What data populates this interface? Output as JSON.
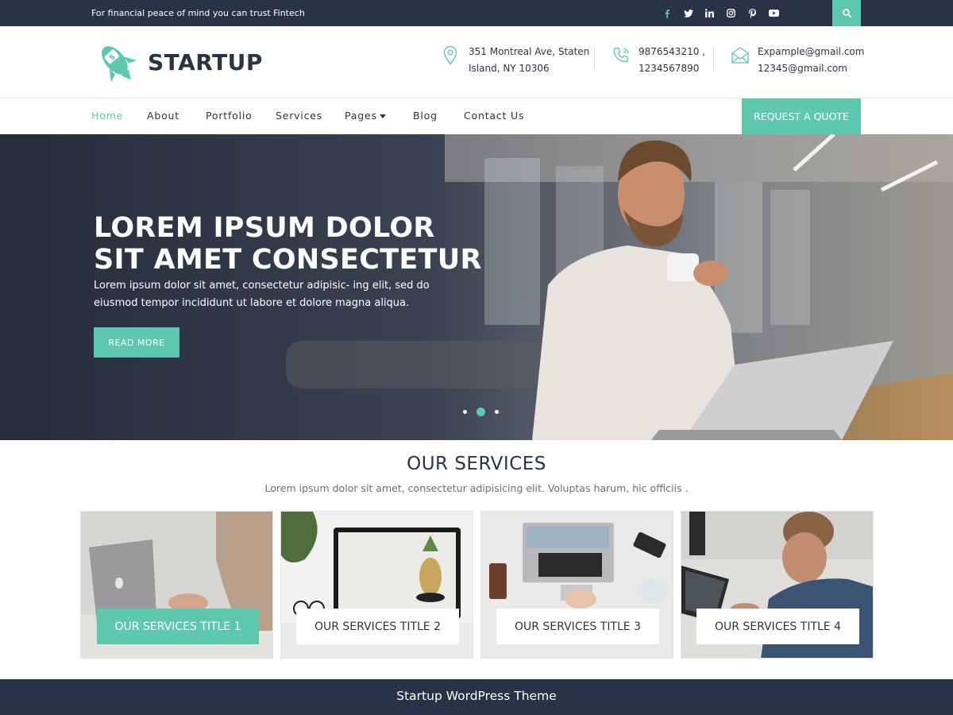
{
  "topbar": {
    "tagline": "For financial peace of mind you can trust Fintech",
    "socials": [
      "facebook-icon",
      "twitter-icon",
      "linkedin-icon",
      "instagram-icon",
      "pinterest-icon",
      "youtube-icon"
    ],
    "search_icon": "search-icon"
  },
  "header": {
    "logo_text": "STARTUP",
    "address_line1": "351 Montreal Ave, Staten",
    "address_line2": "Island, NY 10306",
    "phone_line1": "9876543210 ,",
    "phone_line2": "1234567890",
    "email_line1": "Expample@gmail.com",
    "email_line2": "12345@gmail.com"
  },
  "nav": {
    "items": [
      "Home",
      "About",
      "Portfolio",
      "Services",
      "Pages",
      "Blog",
      "Contact Us"
    ],
    "active": "Home",
    "quote_button": "REQUEST A QUOTE"
  },
  "hero": {
    "title_line1": "LOREM IPSUM DOLOR",
    "title_line2": "SIT AMET CONSECTETUR",
    "text": "Lorem ipsum dolor sit amet, consectetur adipisic- ing elit, sed do eiusmod tempor incididunt ut labore et dolore magna aliqua.",
    "button": "READ MORE",
    "slides": 3,
    "active_slide": 2
  },
  "services": {
    "title": "OUR SERVICES",
    "subtitle": "Lorem ipsum dolor sit amet, consectetur adipisicing elit. Voluptas harum, hic officiis .",
    "cards": [
      {
        "title": "OUR SERVICES TITLE 1"
      },
      {
        "title": "OUR SERVICES TITLE 2"
      },
      {
        "title": "OUR SERVICES TITLE 3"
      },
      {
        "title": "OUR SERVICES TITLE 4"
      }
    ]
  },
  "footer": {
    "text": "Startup WordPress Theme"
  },
  "colors": {
    "accent": "#5ec8ae",
    "dark": "#283347"
  }
}
